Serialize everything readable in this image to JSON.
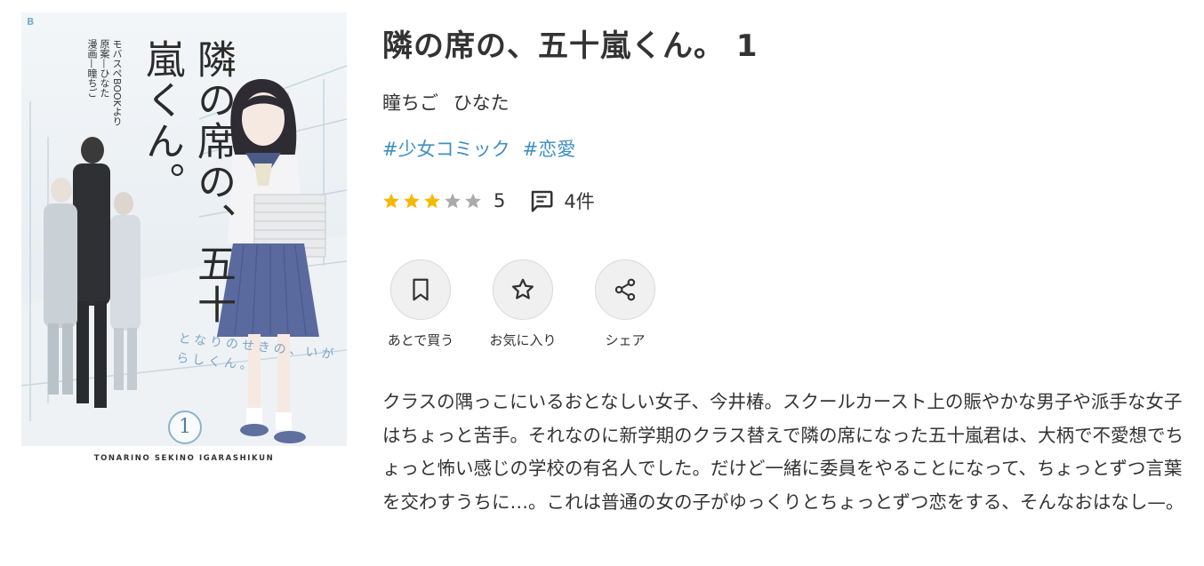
{
  "cover": {
    "publisher_mark": "B",
    "title": "隣の席の、五十嵐くん。",
    "credits": [
      "モバスペBOOKより",
      "原案—ひなた",
      "漫画—瞳ちご"
    ],
    "reading": "となりのせきの、いがらしくん。",
    "volume": "1",
    "romaji": "TONARINO SEKINO IGARASHIKUN"
  },
  "book": {
    "title": "隣の席の、五十嵐くん。 1",
    "authors": [
      "瞳ちご",
      "ひなた"
    ],
    "tags": [
      "#少女コミック",
      "#恋愛"
    ],
    "rating": {
      "stars_filled": 3,
      "stars_total": 5,
      "value": "5",
      "review_count": "4件"
    },
    "description": "クラスの隅っこにいるおとなしい女子、今井椿。スクールカースト上の賑やかな男子や派手な女子はちょっと苦手。それなのに新学期のクラス替えで隣の席になった五十嵐君は、大柄で不愛想でちょっと怖い感じの学校の有名人でした。だけど一緒に委員をやることになって、ちょっとずつ言葉を交わすうちに…。これは普通の女の子がゆっくりとちょっとずつ恋をする、そんなおはなし—。"
  },
  "actions": {
    "buy_later": {
      "label": "あとで買う",
      "icon": "bookmark-icon"
    },
    "favorite": {
      "label": "お気に入り",
      "icon": "star-outline-icon"
    },
    "share": {
      "label": "シェア",
      "icon": "share-icon"
    }
  },
  "colors": {
    "text": "#333333",
    "tag": "#3f8fc2",
    "star_filled": "#f5b800",
    "star_empty": "#aaaaaa",
    "action_bg": "#f0f0f0"
  }
}
